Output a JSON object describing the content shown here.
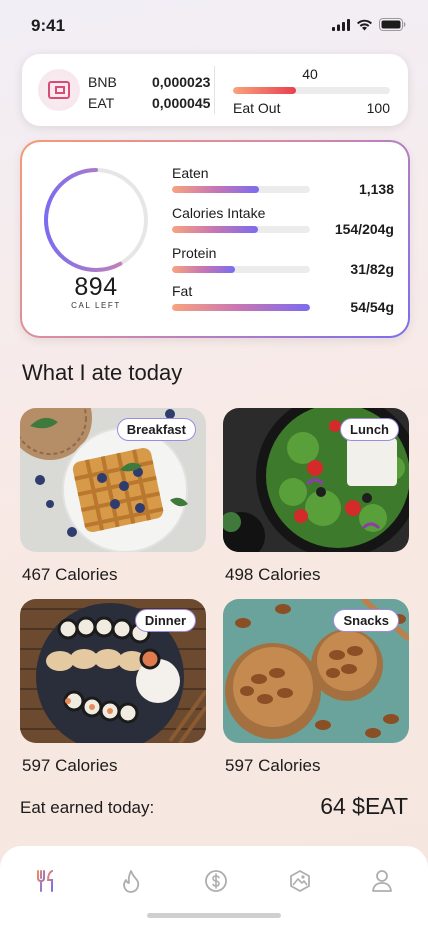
{
  "status_bar": {
    "time": "9:41"
  },
  "wallet": {
    "tokens": [
      {
        "symbol": "BNB",
        "amount": "0,000023"
      },
      {
        "symbol": "EAT",
        "amount": "0,000045"
      }
    ],
    "eat_out": {
      "current": "40",
      "label": "Eat Out",
      "max": "100",
      "progress_fraction": 0.4
    }
  },
  "nutrition": {
    "calories_left": "894",
    "calories_left_label": "CAL LEFT",
    "ring_progress_fraction": 0.58,
    "stats": [
      {
        "label": "Eaten",
        "value": "1,138",
        "progress_fraction": 0.63
      },
      {
        "label": "Calories Intake",
        "value": "154/204g",
        "progress_fraction": 0.62
      },
      {
        "label": "Protein",
        "value": "31/82g",
        "progress_fraction": 0.46
      },
      {
        "label": "Fat",
        "value": "54/54g",
        "progress_fraction": 1.0
      }
    ]
  },
  "section_title": "What I ate today",
  "meals": [
    {
      "name": "Breakfast",
      "calories": "467 Calories",
      "image": "waffles-photo"
    },
    {
      "name": "Lunch",
      "calories": "498 Calories",
      "image": "greek-salad-photo"
    },
    {
      "name": "Dinner",
      "calories": "597 Calories",
      "image": "sushi-platter-photo"
    },
    {
      "name": "Snacks",
      "calories": "597 Calories",
      "image": "almonds-bowl-photo"
    }
  ],
  "earned": {
    "label": "Eat earned today:",
    "value": "64 $EAT"
  },
  "nav": [
    {
      "id": "meals",
      "icon": "fork-knife-icon",
      "active": true
    },
    {
      "id": "burn",
      "icon": "flame-icon",
      "active": false
    },
    {
      "id": "wallet",
      "icon": "dollar-coin-icon",
      "active": false
    },
    {
      "id": "gallery",
      "icon": "mountain-image-icon",
      "active": false
    },
    {
      "id": "profile",
      "icon": "user-icon",
      "active": false
    }
  ],
  "colors": {
    "accent_orange": "#f9a37e",
    "accent_purple": "#7b6cf0",
    "accent_red": "#e8404f",
    "badge_border": "#9f8ae0"
  }
}
